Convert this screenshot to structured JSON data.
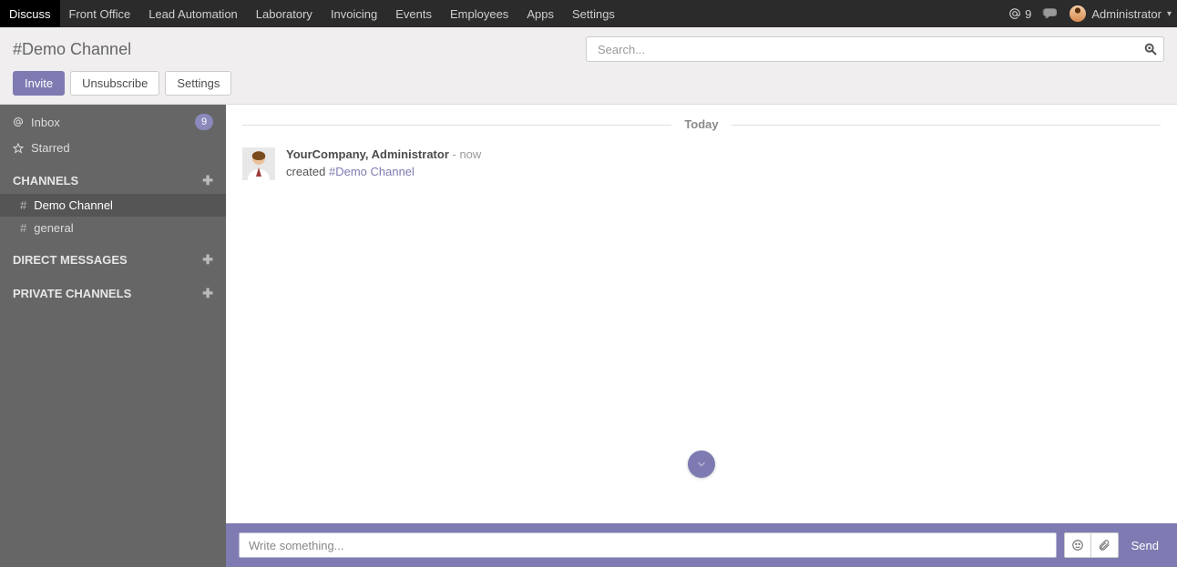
{
  "topnav": {
    "items": [
      "Discuss",
      "Front Office",
      "Lead Automation",
      "Laboratory",
      "Invoicing",
      "Events",
      "Employees",
      "Apps",
      "Settings"
    ],
    "active_index": 0,
    "mention_count": "9",
    "user_name": "Administrator"
  },
  "subheader": {
    "channel_title": "#Demo Channel",
    "search_placeholder": "Search...",
    "buttons": {
      "invite": "Invite",
      "unsubscribe": "Unsubscribe",
      "settings": "Settings"
    }
  },
  "sidebar": {
    "inbox_label": "Inbox",
    "inbox_count": "9",
    "starred_label": "Starred",
    "sections": {
      "channels": "CHANNELS",
      "direct": "DIRECT MESSAGES",
      "private": "PRIVATE CHANNELS"
    },
    "channels": [
      {
        "name": "Demo Channel",
        "active": true
      },
      {
        "name": "general",
        "active": false
      }
    ]
  },
  "thread": {
    "date_separator": "Today",
    "message": {
      "author": "YourCompany, Administrator",
      "sep": " - ",
      "time": "now",
      "action_prefix": "created ",
      "channel_link": "#Demo Channel"
    }
  },
  "composer": {
    "placeholder": "Write something...",
    "send_label": "Send"
  },
  "icons": {
    "at": "at-icon",
    "conversations": "conversations-icon",
    "caret_down": "chevron-down-icon",
    "search": "search-icon",
    "star": "star-icon",
    "plus": "plus-icon",
    "hash": "#",
    "smiley": "smiley-icon",
    "paperclip": "paperclip-icon",
    "scroll_down": "chevron-down-icon"
  },
  "colors": {
    "accent": "#7e7bb2",
    "navbar": "#2b2b2b",
    "sidebar": "#666666"
  }
}
